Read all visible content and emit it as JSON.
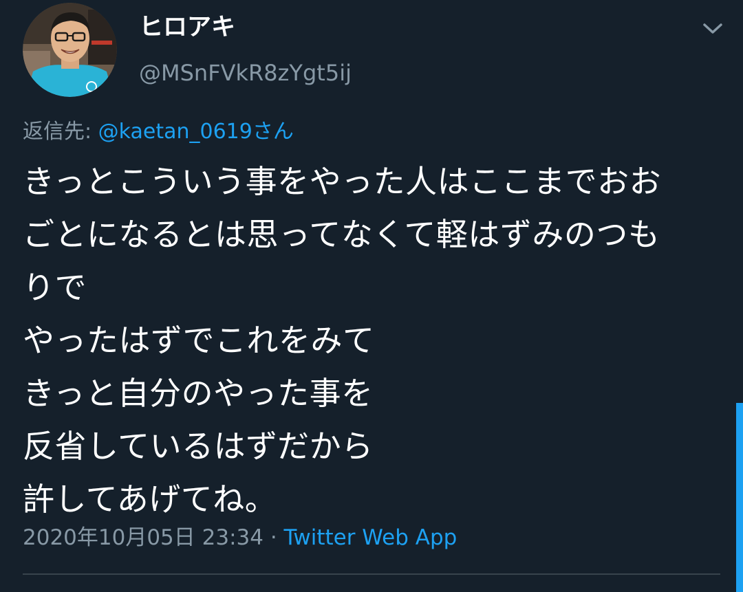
{
  "author": {
    "display_name": "ヒロアキ",
    "handle": "@MSnFVkR8zYgt5ij",
    "avatar_icon": "avatar-photo"
  },
  "reply": {
    "prefix": "返信先: ",
    "to_user": "@kaetan_0619さん"
  },
  "body": {
    "lines": [
      "きっとこういう事をやった人はここまでおお",
      "ごとになるとは思ってなくて軽はずみのつも",
      "りで",
      "やったはずでこれをみて",
      "きっと自分のやった事を",
      "反省しているはずだから",
      "許してあげてね。"
    ]
  },
  "meta": {
    "timestamp": "2020年10月05日 23:34",
    "separator": " · ",
    "source": "Twitter Web App"
  },
  "icons": {
    "menu": "chevron-down-icon"
  },
  "colors": {
    "background": "#15202b",
    "accent": "#1da1f2",
    "secondary_text": "#8899a6",
    "primary_text": "#ffffff",
    "divider": "#38444d"
  }
}
